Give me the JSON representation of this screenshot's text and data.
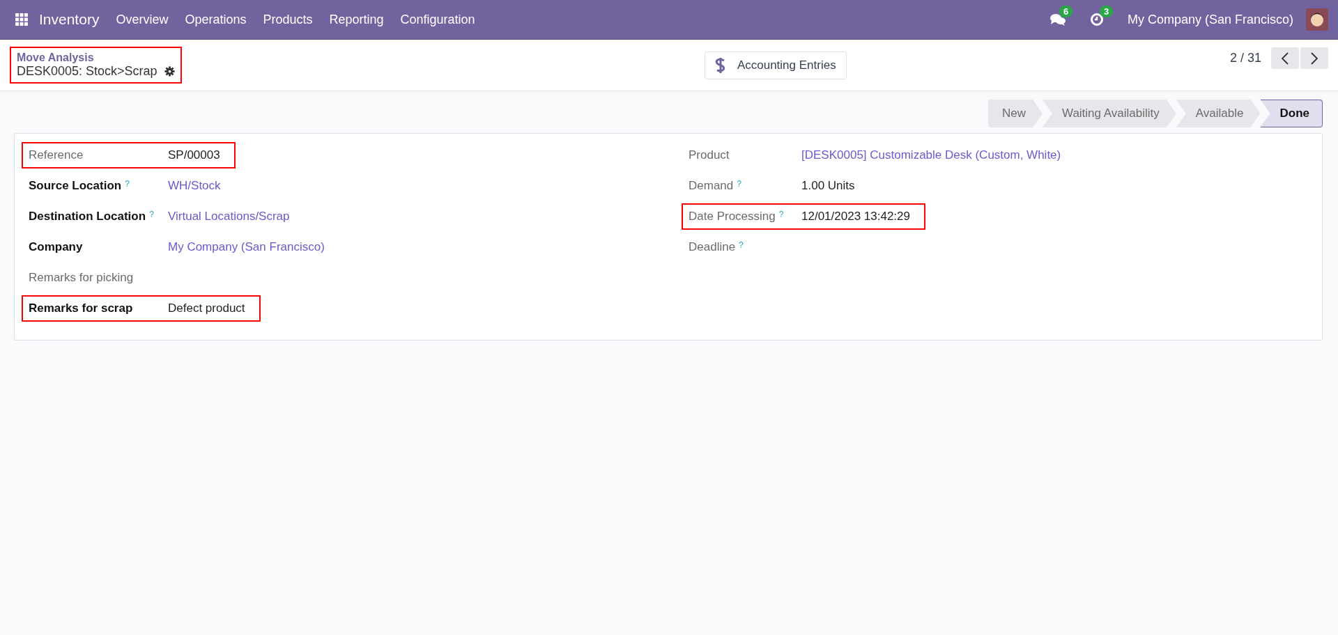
{
  "navbar": {
    "app_name": "Inventory",
    "menu": [
      "Overview",
      "Operations",
      "Products",
      "Reporting",
      "Configuration"
    ],
    "messages_count": "6",
    "activities_count": "3",
    "company": "My Company (San Francisco)"
  },
  "breadcrumb": {
    "parent": "Move Analysis",
    "current": "DESK0005: Stock>Scrap",
    "highlighted": true
  },
  "smart_button": {
    "label": "Accounting Entries"
  },
  "pager": {
    "text": "2 / 31"
  },
  "status_bar": [
    {
      "label": "New",
      "selected": false
    },
    {
      "label": "Waiting Availability",
      "selected": false
    },
    {
      "label": "Available",
      "selected": false
    },
    {
      "label": "Done",
      "selected": true
    }
  ],
  "left_fields": [
    {
      "label": "Reference",
      "value": "SP/00003",
      "readonly": true,
      "link": false,
      "highlighted": true
    },
    {
      "label": "Source Location",
      "help": "?",
      "value": "WH/Stock",
      "readonly": false,
      "link": true,
      "highlighted": false
    },
    {
      "label": "Destination Location",
      "help": "?",
      "value": "Virtual Locations/Scrap",
      "readonly": false,
      "link": true,
      "highlighted": false
    },
    {
      "label": "Company",
      "value": "My Company (San Francisco)",
      "readonly": false,
      "link": true,
      "highlighted": false
    },
    {
      "label": "Remarks for picking",
      "readonly": true,
      "highlighted": false
    },
    {
      "label": "Remarks for scrap",
      "value": "Defect product",
      "readonly": false,
      "link": false,
      "highlighted": true
    }
  ],
  "right_fields": [
    {
      "label": "Product",
      "value": "[DESK0005] Customizable Desk (Custom, White)",
      "readonly": true,
      "link": true,
      "highlighted": false
    },
    {
      "label": "Demand",
      "help": "?",
      "value": "1.00 Units",
      "readonly": true,
      "link": false,
      "highlighted": false
    },
    {
      "label": "Date Processing",
      "help": "?",
      "value": "12/01/2023 13:42:29",
      "readonly": true,
      "link": false,
      "highlighted": true
    },
    {
      "label": "Deadline",
      "help": "?",
      "readonly": true,
      "highlighted": false
    }
  ]
}
